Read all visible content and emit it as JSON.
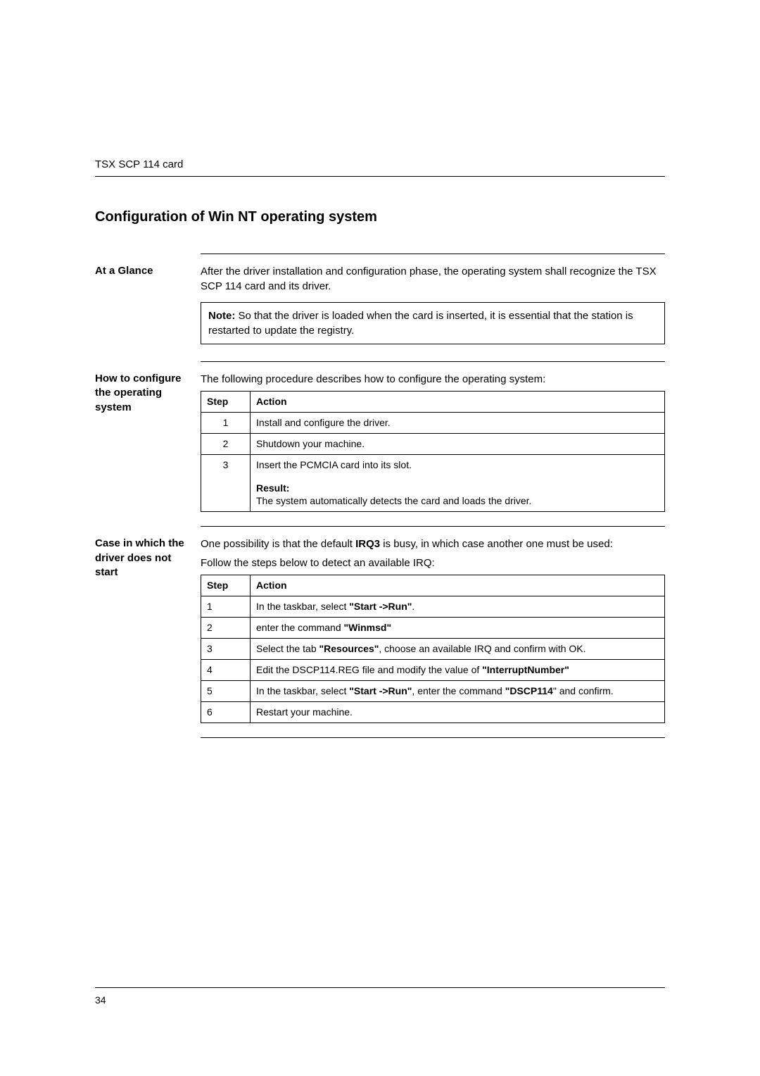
{
  "running_head": "TSX SCP 114 card",
  "title": "Configuration of Win NT operating system",
  "glance": {
    "label": "At a Glance",
    "para1": "After the driver installation and configuration phase, the operating system shall recognize the TSX SCP 114 card and its driver.",
    "note_label": "Note:",
    "note_text": " So that the driver is loaded when the card is inserted, it is essential that the station is restarted to update the registry."
  },
  "configure": {
    "label": "How to configure the operating system",
    "intro": "The following procedure describes how to configure the operating system:",
    "headers": {
      "step": "Step",
      "action": "Action"
    },
    "rows": [
      {
        "step": "1",
        "action": "Install and configure the driver."
      },
      {
        "step": "2",
        "action": "Shutdown your machine."
      },
      {
        "step": "3",
        "action": "Insert the PCMCIA card into its slot.",
        "result_label": "Result:",
        "result_text": "The system automatically detects the card and loads the driver."
      }
    ]
  },
  "driver_fail": {
    "label": "Case in which the driver does not start",
    "intro_pre": "One possibility is that the default ",
    "intro_bold": "IRQ3",
    "intro_post": " is busy, in which case another one must be used:",
    "intro2": "Follow the steps below to detect an available IRQ:",
    "headers": {
      "step": "Step",
      "action": "Action"
    },
    "rows": [
      {
        "step": "1",
        "pre": "In the taskbar, select ",
        "b1": "\"Start ->Run\"",
        "post": "."
      },
      {
        "step": "2",
        "pre": "enter the command ",
        "b1": "\"Winmsd\"",
        "post": ""
      },
      {
        "step": "3",
        "pre": "Select the tab ",
        "b1": "\"Resources\"",
        "post": ", choose an available IRQ and confirm with OK."
      },
      {
        "step": "4",
        "pre": "Edit the DSCP114.REG file and modify the value of ",
        "b1": "\"InterruptNumber\"",
        "post": ""
      },
      {
        "step": "5",
        "pre": "In the taskbar, select ",
        "b1": "\"Start ->Run\"",
        "mid": ", enter the command ",
        "b2": "\"DSCP114",
        "post": "\" and confirm."
      },
      {
        "step": "6",
        "pre": "Restart your machine.",
        "b1": "",
        "post": ""
      }
    ]
  },
  "page_number": "34"
}
